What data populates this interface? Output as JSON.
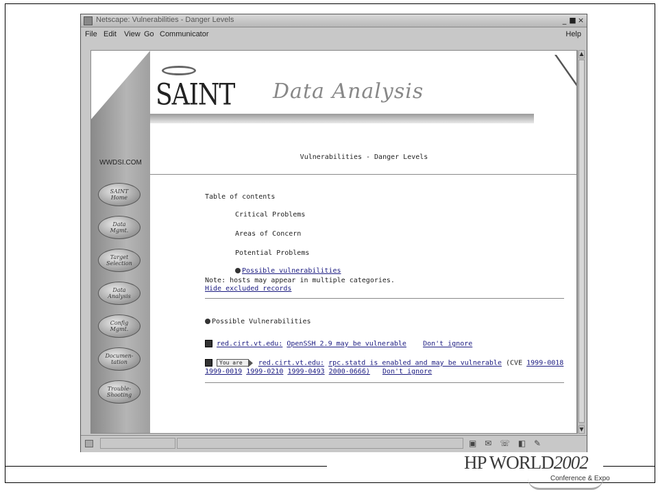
{
  "window": {
    "title": "Netscape: Vulnerabilities - Danger Levels",
    "controls": {
      "minimize": "_",
      "maximize": "■",
      "close": "×"
    }
  },
  "menubar": {
    "items": [
      "File",
      "Edit",
      "View",
      "Go",
      "Communicator"
    ],
    "help": "Help"
  },
  "banner": {
    "logo": "SAINT",
    "title": "Data Analysis"
  },
  "sidebar": {
    "site": "WWDSI.COM",
    "items": [
      {
        "label": "SAINT\nHome"
      },
      {
        "label": "Data\nMgmt."
      },
      {
        "label": "Target\nSelection"
      },
      {
        "label": "Data\nAnalysis"
      },
      {
        "label": "Config\nMgmt."
      },
      {
        "label": "Documen-\ntation"
      },
      {
        "label": "Trouble-\nShooting"
      }
    ]
  },
  "page": {
    "heading": "Vulnerabilities - Danger Levels",
    "toc_title": "Table of contents",
    "toc_items": [
      "Critical Problems",
      "Areas of Concern",
      "Potential Problems"
    ],
    "toc_link": "Possible vulnerabilities",
    "note": "Note: hosts may appear in multiple categories.",
    "hide_link": "Hide excluded records",
    "section_title": "Possible Vulnerabilities",
    "vulns": [
      {
        "host": "red.cirt.vt.edu:",
        "desc": "OpenSSH 2.9 may be vulnerable",
        "ignore": "Don't ignore"
      },
      {
        "badge": "You are",
        "host": "red.cirt.vt.edu:",
        "desc": "rpc.statd is enabled and may be vulnerable",
        "cve_prefix": "(CVE",
        "cves_line1": [
          "1999-0018"
        ],
        "cves_line2": [
          "1999-0019",
          "1999-0210",
          "1999-0493",
          "2000-0666)"
        ],
        "ignore": "Don't ignore"
      }
    ]
  },
  "footer": {
    "brand": "HP WORLD",
    "year": "2002",
    "sub": "Conference & Expo"
  }
}
